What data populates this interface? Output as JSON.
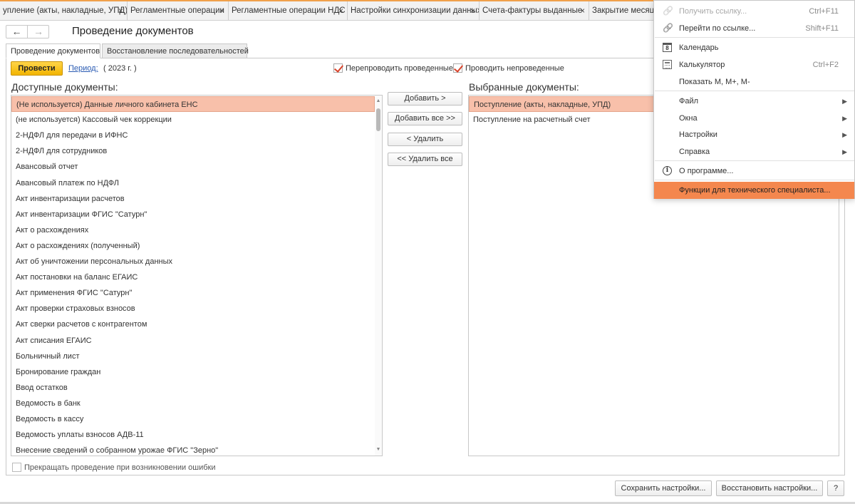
{
  "tabs": [
    {
      "label": "упление (акты, накладные, УПД)"
    },
    {
      "label": "Регламентные операции"
    },
    {
      "label": "Регламентные операции НДС"
    },
    {
      "label": "Настройки синхронизации данных"
    },
    {
      "label": "Счета-фактуры выданные"
    },
    {
      "label": "Закрытие месяца"
    }
  ],
  "tab_close_glyph": "×",
  "nav": {
    "back": "←",
    "forward": "→"
  },
  "page_title": "Проведение документов",
  "form_tabs": [
    "Проведение документов",
    "Восстановление последовательностей"
  ],
  "toolbar": {
    "post_button": "Провести",
    "period_link": "Период:",
    "period_value": "( 2023 г. )",
    "repost_label": "Перепроводить проведенные",
    "repost_checked": true,
    "post_unposted_label": "Проводить непроведенные",
    "post_unposted_checked": true
  },
  "available": {
    "heading": "Доступные документы:",
    "items": [
      "(Не используется) Данные личного кабинета ЕНС",
      "(не используется) Кассовый чек коррекции",
      "2-НДФЛ для передачи в ИФНС",
      "2-НДФЛ для сотрудников",
      "Авансовый отчет",
      "Авансовый платеж по НДФЛ",
      "Акт инвентаризации расчетов",
      "Акт инвентаризации ФГИС \"Сатурн\"",
      "Акт о расхождениях",
      "Акт о расхождениях (полученный)",
      "Акт об уничтожении персональных данных",
      "Акт постановки на баланс ЕГАИС",
      "Акт применения ФГИС \"Сатурн\"",
      "Акт проверки страховых взносов",
      "Акт сверки расчетов с контрагентом",
      "Акт списания ЕГАИС",
      "Больничный лист",
      "Бронирование граждан",
      "Ввод остатков",
      "Ведомость в банк",
      "Ведомость в кассу",
      "Ведомость уплаты взносов АДВ-11",
      "Внесение сведений о собранном урожае ФГИС \"Зерно\""
    ]
  },
  "mid_buttons": {
    "add": "Добавить >",
    "add_all": "Добавить все >>",
    "remove": "< Удалить",
    "remove_all": "<< Удалить все"
  },
  "selected": {
    "heading": "Выбранные документы:",
    "items": [
      "Поступление (акты, накладные, УПД)",
      "Поступление на расчетный счет"
    ]
  },
  "stop_on_error_label": "Прекращать проведение при возникновении ошибки",
  "bottom_buttons": {
    "save": "Сохранить настройки...",
    "restore": "Восстановить настройки...",
    "help": "?"
  },
  "menu": [
    {
      "label": "Получить ссылку...",
      "shortcut": "Ctrl+F11",
      "icon": "link-icon",
      "glyph": "🔗",
      "disabled": true
    },
    {
      "label": "Перейти по ссылке...",
      "shortcut": "Shift+F11",
      "icon": "link-go-icon",
      "glyph": "🔗"
    },
    {
      "label": "Календарь",
      "icon": "calendar-icon",
      "glyph": "8"
    },
    {
      "label": "Калькулятор",
      "shortcut": "Ctrl+F2",
      "icon": "calculator-icon",
      "glyph": ""
    },
    {
      "label": "Показать М, М+, М-"
    },
    {
      "label": "Файл",
      "submenu": true
    },
    {
      "label": "Окна",
      "submenu": true
    },
    {
      "label": "Настройки",
      "submenu": true
    },
    {
      "label": "Справка",
      "submenu": true
    },
    {
      "label": "О программе...",
      "icon": "info-icon",
      "glyph": "i"
    },
    {
      "label": "Функции для технического специалиста...",
      "highlighted": true
    }
  ],
  "colors": {
    "accent_orange": "#f4874e",
    "post_button_yellow": "#f2b400",
    "selection_pink": "#f8c0aa",
    "link_blue": "#2a5bb3",
    "checkbox_red": "#d9432b"
  }
}
